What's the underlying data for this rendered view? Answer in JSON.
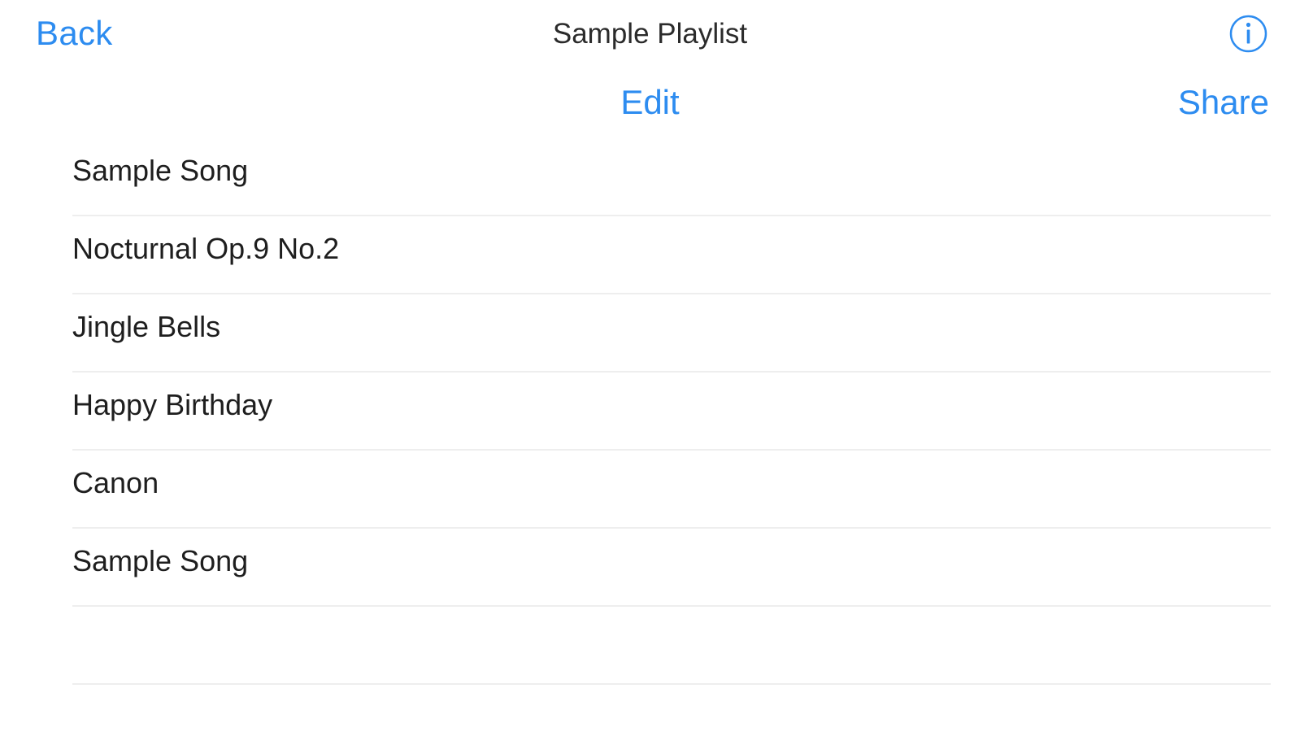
{
  "nav": {
    "back_label": "Back",
    "title": "Sample Playlist",
    "info_icon": "info-circle-icon"
  },
  "toolbar": {
    "edit_label": "Edit",
    "share_label": "Share"
  },
  "songs": [
    {
      "title": "Sample Song"
    },
    {
      "title": "Nocturnal Op.9 No.2"
    },
    {
      "title": "Jingle Bells"
    },
    {
      "title": "Happy Birthday"
    },
    {
      "title": "Canon"
    },
    {
      "title": "Sample Song"
    },
    {
      "title": ""
    }
  ],
  "colors": {
    "accent": "#2d8cf0",
    "text": "#1e1e1e",
    "separator": "#eeeeee",
    "background": "#ffffff"
  }
}
